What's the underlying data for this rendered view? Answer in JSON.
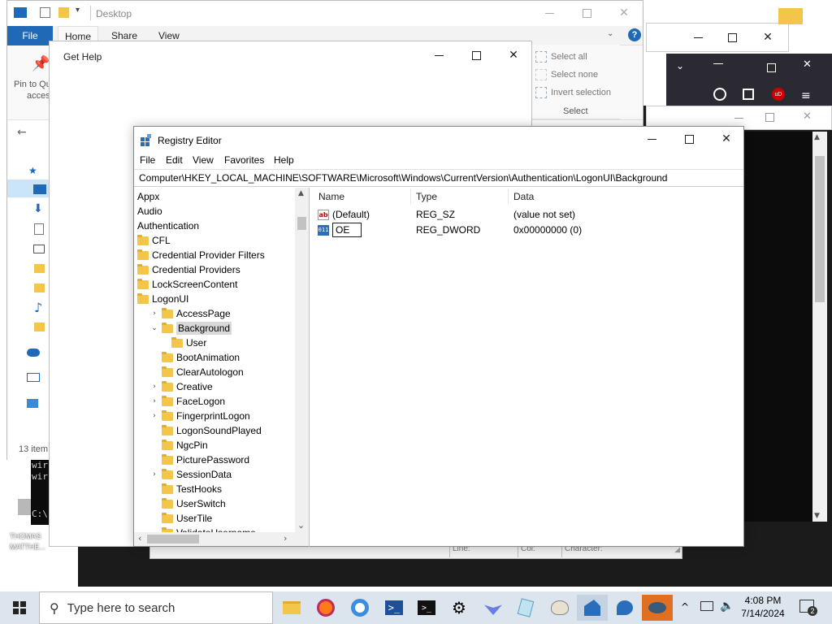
{
  "explorer": {
    "title": "Desktop",
    "tabs": [
      "File",
      "Home",
      "Share",
      "View"
    ],
    "pin_label_line1": "Pin to Qu",
    "pin_label_line2": "access",
    "ribbon_select": {
      "select_all": "Select all",
      "select_none": "Select none",
      "invert_selection": "Invert selection",
      "group_label": "Select"
    },
    "status": "13 item"
  },
  "gethelp": {
    "title": "Get Help"
  },
  "terminal_lines": [
    "wir",
    "wir",
    "C:\\"
  ],
  "desktop_labels": [
    "THOMAS",
    "MATTHE..."
  ],
  "notepad_status": {
    "line": "Line:",
    "col": "Col:",
    "character": "Character:"
  },
  "regedit": {
    "title": "Registry Editor",
    "menu": [
      "File",
      "Edit",
      "View",
      "Favorites",
      "Help"
    ],
    "address": "Computer\\HKEY_LOCAL_MACHINE\\SOFTWARE\\Microsoft\\Windows\\CurrentVersion\\Authentication\\LogonUI\\Background",
    "tree": [
      {
        "label": "Appx",
        "level": 0,
        "folder": false
      },
      {
        "label": "Audio",
        "level": 0,
        "folder": false
      },
      {
        "label": "Authentication",
        "level": 0,
        "folder": false
      },
      {
        "label": "CFL",
        "level": 1,
        "folder": true
      },
      {
        "label": "Credential Provider Filters",
        "level": 1,
        "folder": true
      },
      {
        "label": "Credential Providers",
        "level": 1,
        "folder": true
      },
      {
        "label": "LockScreenContent",
        "level": 1,
        "folder": true
      },
      {
        "label": "LogonUI",
        "level": 1,
        "folder": true
      },
      {
        "label": "AccessPage",
        "level": 2,
        "folder": true,
        "chevron": "right"
      },
      {
        "label": "Background",
        "level": 2,
        "folder": true,
        "chevron": "down",
        "selected": true
      },
      {
        "label": "User",
        "level": 3,
        "folder": true
      },
      {
        "label": "BootAnimation",
        "level": 2,
        "folder": true
      },
      {
        "label": "ClearAutologon",
        "level": 2,
        "folder": true
      },
      {
        "label": "Creative",
        "level": 2,
        "folder": true,
        "chevron": "right"
      },
      {
        "label": "FaceLogon",
        "level": 2,
        "folder": true,
        "chevron": "right"
      },
      {
        "label": "FingerprintLogon",
        "level": 2,
        "folder": true,
        "chevron": "right"
      },
      {
        "label": "LogonSoundPlayed",
        "level": 2,
        "folder": true
      },
      {
        "label": "NgcPin",
        "level": 2,
        "folder": true
      },
      {
        "label": "PicturePassword",
        "level": 2,
        "folder": true
      },
      {
        "label": "SessionData",
        "level": 2,
        "folder": true,
        "chevron": "right"
      },
      {
        "label": "TestHooks",
        "level": 2,
        "folder": true
      },
      {
        "label": "UserSwitch",
        "level": 2,
        "folder": true
      },
      {
        "label": "UserTile",
        "level": 2,
        "folder": true
      },
      {
        "label": "ValidateUsername",
        "level": 2,
        "folder": true
      }
    ],
    "columns": {
      "name": "Name",
      "type": "Type",
      "data": "Data"
    },
    "values": [
      {
        "name": "(Default)",
        "type": "REG_SZ",
        "data": "(value not set)",
        "icon": "ab-icon"
      },
      {
        "name": "OE",
        "type": "REG_DWORD",
        "data": "0x00000000 (0)",
        "icon": "binary-icon",
        "renaming": true
      }
    ]
  },
  "taskbar": {
    "search_placeholder": "Type here to search",
    "time": "4:08 PM",
    "date": "7/14/2024",
    "notification_count": "2"
  }
}
